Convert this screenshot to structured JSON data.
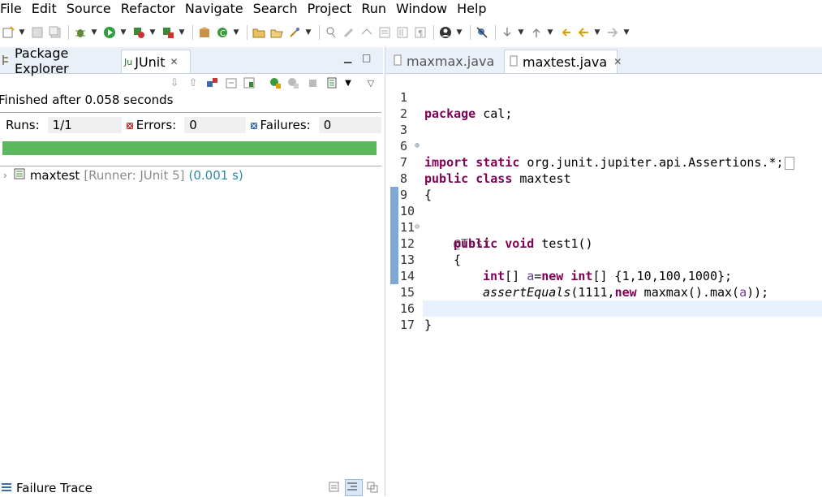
{
  "menu": [
    "File",
    "Edit",
    "Source",
    "Refactor",
    "Navigate",
    "Search",
    "Project",
    "Run",
    "Window",
    "Help"
  ],
  "toolbar_icons": [
    "new-icon",
    "save-icon",
    "save-all-icon",
    "debug-icon",
    "run-icon",
    "coverage-icon",
    "external-tools-icon",
    "new-package-icon",
    "new-class-icon",
    "open-type-icon",
    "open-task-icon",
    "search-icon",
    "toggle-breadcrumb-icon",
    "mark-occurrences-icon",
    "block-selection-icon",
    "word-wrap-icon",
    "show-whitespace-icon",
    "pin-icon",
    "skip-breakpoints-icon",
    "next-annotation-icon",
    "prev-annotation-icon",
    "last-edit-icon",
    "back-icon",
    "forward-icon"
  ],
  "left_view": {
    "tabs": [
      {
        "label": "Package Explorer",
        "active": false
      },
      {
        "label": "JUnit",
        "active": true
      }
    ],
    "finished": "Finished after 0.058 seconds",
    "runs_label": "Runs:",
    "runs_value": "1/1",
    "errors_label": "Errors:",
    "errors_value": "0",
    "failures_label": "Failures:",
    "failures_value": "0",
    "progress": 1.0,
    "progress_color": "#5cb85c",
    "tree": {
      "name": "maxtest",
      "runner": "[Runner: JUnit 5]",
      "time": "(0.001 s)"
    },
    "failure_trace": "Failure Trace"
  },
  "editor": {
    "tabs": [
      {
        "label": "maxmax.java",
        "active": false
      },
      {
        "label": "maxtest.java",
        "active": true
      }
    ],
    "lines": [
      {
        "n": "1"
      },
      {
        "n": "2"
      },
      {
        "n": "3"
      },
      {
        "n": "6"
      },
      {
        "n": "7"
      },
      {
        "n": "8"
      },
      {
        "n": "9"
      },
      {
        "n": "10"
      },
      {
        "n": "11"
      },
      {
        "n": "12"
      },
      {
        "n": "13"
      },
      {
        "n": "14"
      },
      {
        "n": "15"
      },
      {
        "n": "16"
      },
      {
        "n": "17"
      }
    ],
    "code": {
      "l1_kw": "package",
      "l1_rest": " cal;",
      "l3_kw": "import static",
      "l3_rest": " org.junit.jupiter.api.Assertions.*;",
      "l7_kw": "public class",
      "l7_rest": " maxtest",
      "l8": "{",
      "l10": "@Test",
      "l11_kw": "public void",
      "l11_rest": " test1()",
      "l12": "{",
      "l13_kw1": "int",
      "l13_a": "[] ",
      "l13_var": "a",
      "l13_b": "=",
      "l13_kw2": "new",
      "l13_c": " ",
      "l13_kw3": "int",
      "l13_d": "[] {1,10,100,1000};",
      "l14_it": "assertEquals",
      "l14_a": "(1111,",
      "l14_kw": "new",
      "l14_b": " maxmax().max(",
      "l14_var": "a",
      "l14_c": "));",
      "l15": "}",
      "l16": "}"
    }
  }
}
